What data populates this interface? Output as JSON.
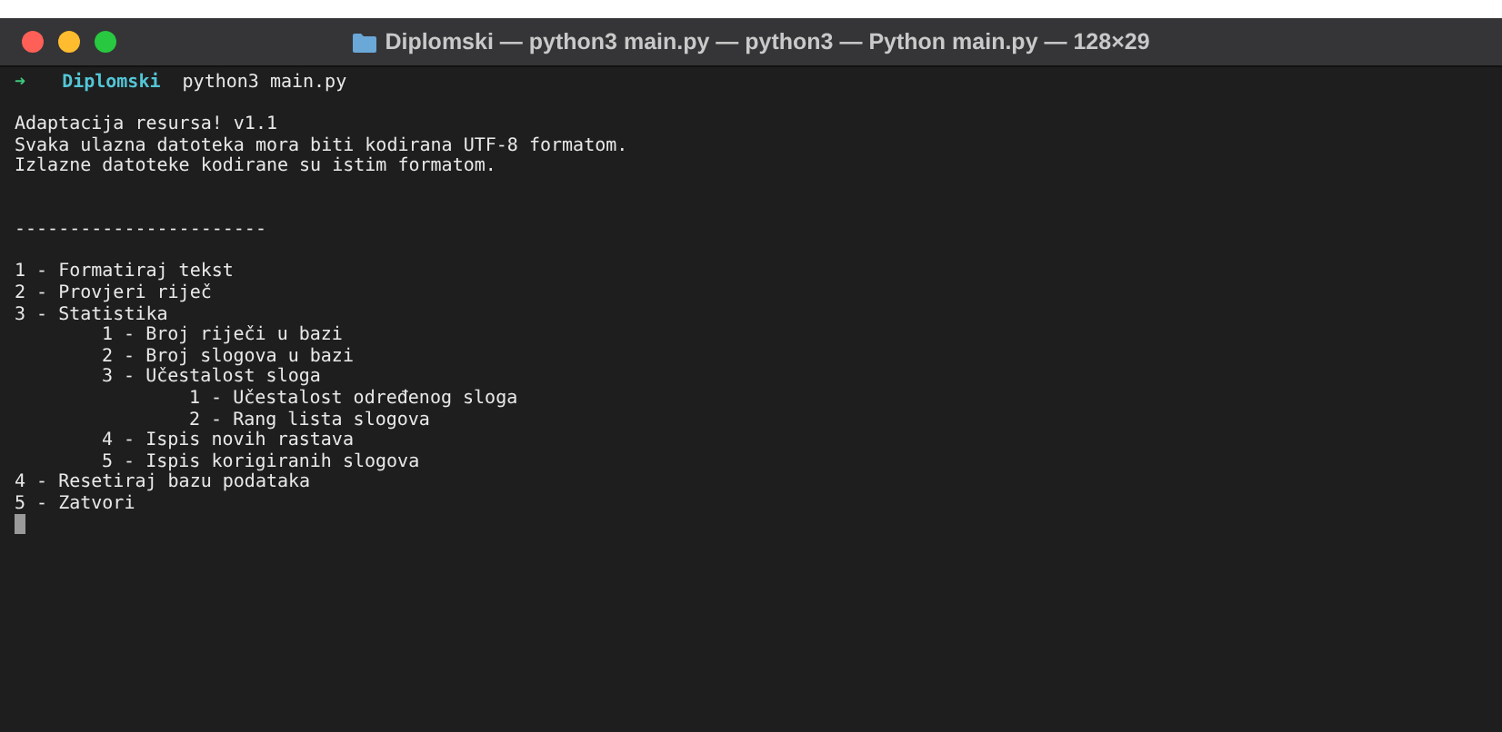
{
  "window": {
    "title": "Diplomski — python3 main.py — python3 — Python main.py — 128×29"
  },
  "prompt": {
    "arrow": "➜",
    "directory": "Diplomski",
    "command": "python3 main.py"
  },
  "output_blocks": [
    [
      "Adaptacija resursa! v1.1",
      "Svaka ulazna datoteka mora biti kodirana UTF-8 formatom.",
      "Izlazne datoteke kodirane su istim formatom."
    ],
    [
      "-----------------------"
    ]
  ],
  "menu": [
    {
      "label": "1 - Formatiraj tekst"
    },
    {
      "label": "2 - Provjeri riječ"
    },
    {
      "label": "3 - Statistika",
      "children": [
        {
          "label": "1 - Broj riječi u bazi"
        },
        {
          "label": "2 - Broj slogova u bazi"
        },
        {
          "label": "3 - Učestalost sloga",
          "children": [
            {
              "label": "1 - Učestalost određenog sloga"
            },
            {
              "label": "2 - Rang lista slogova"
            }
          ]
        },
        {
          "label": "4 - Ispis novih rastava"
        },
        {
          "label": "5 - Ispis korigiranih slogova"
        }
      ]
    },
    {
      "label": "4 - Resetiraj bazu podataka"
    },
    {
      "label": "5 - Zatvori"
    }
  ]
}
